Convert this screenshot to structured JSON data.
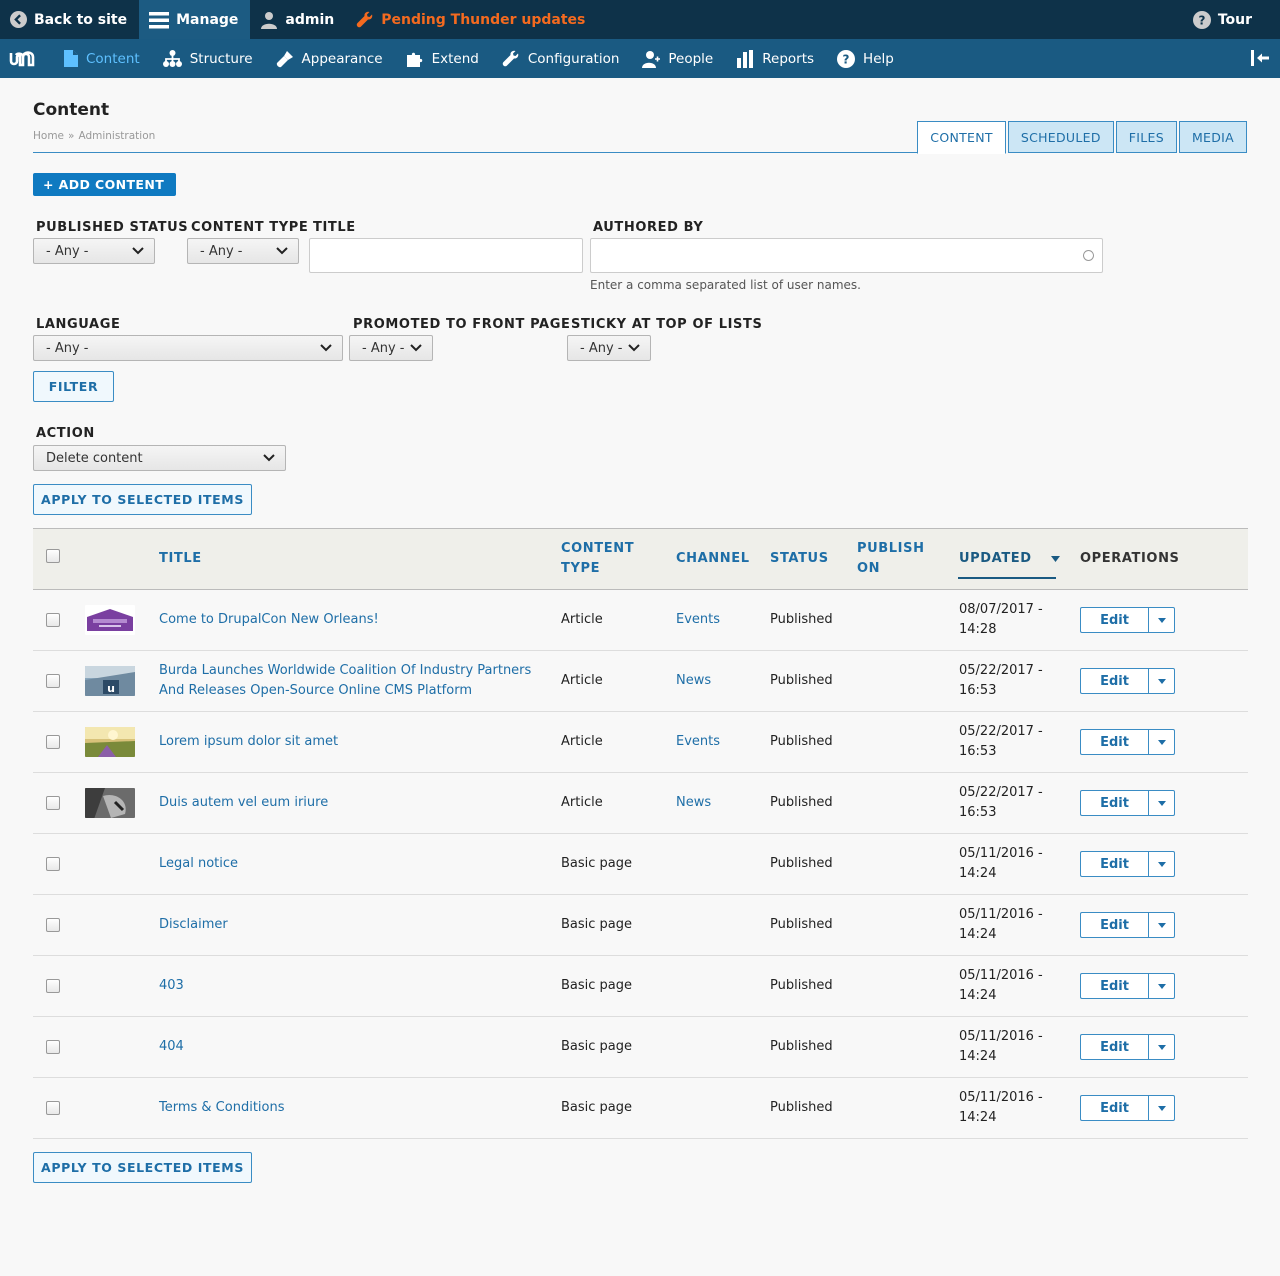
{
  "toolbar": {
    "back_label": "Back to site",
    "manage_label": "Manage",
    "user_label": "admin",
    "pending_label": "Pending Thunder updates",
    "tour_label": "Tour"
  },
  "tray": {
    "items": [
      {
        "label": "Content"
      },
      {
        "label": "Structure"
      },
      {
        "label": "Appearance"
      },
      {
        "label": "Extend"
      },
      {
        "label": "Configuration"
      },
      {
        "label": "People"
      },
      {
        "label": "Reports"
      },
      {
        "label": "Help"
      }
    ]
  },
  "page": {
    "title": "Content",
    "breadcrumb": [
      "Home",
      "Administration"
    ],
    "breadcrumb_sep": "»",
    "tabs": [
      "CONTENT",
      "SCHEDULED",
      "FILES",
      "MEDIA"
    ],
    "add_content": "+ ADD CONTENT"
  },
  "filters": {
    "published_status": {
      "label": "PUBLISHED STATUS",
      "value": "- Any -"
    },
    "content_type": {
      "label": "CONTENT TYPE",
      "value": "- Any -"
    },
    "title": {
      "label": "TITLE",
      "value": ""
    },
    "authored_by": {
      "label": "AUTHORED BY",
      "value": "",
      "description": "Enter a comma separated list of user names."
    },
    "language": {
      "label": "LANGUAGE",
      "value": "- Any -"
    },
    "promoted": {
      "label": "PROMOTED TO FRONT PAGE",
      "value": "- Any -"
    },
    "sticky": {
      "label": "STICKY AT TOP OF LISTS",
      "value": "- Any -"
    },
    "filter_button": "FILTER"
  },
  "bulk": {
    "action_label": "ACTION",
    "action_value": "Delete content",
    "apply_label": "APPLY TO SELECTED ITEMS"
  },
  "table": {
    "headers": {
      "title": "TITLE",
      "content_type_1": "CONTENT",
      "content_type_2": "TYPE",
      "channel": "CHANNEL",
      "status": "STATUS",
      "publish_on_1": "PUBLISH",
      "publish_on_2": "ON",
      "updated": "UPDATED",
      "operations": "OPERATIONS"
    },
    "edit_label": "Edit",
    "rows": [
      {
        "title_1": "Come to DrupalCon New Orleans!",
        "title_2": "",
        "type": "Article",
        "channel": "Events",
        "status": "Published",
        "date": "08/07/2017 -",
        "time": "14:28"
      },
      {
        "title_1": "Burda Launches Worldwide Coalition Of Industry Partners",
        "title_2": "And Releases Open-Source Online CMS Platform",
        "type": "Article",
        "channel": "News",
        "status": "Published",
        "date": "05/22/2017 -",
        "time": "16:53"
      },
      {
        "title_1": "Lorem ipsum dolor sit amet",
        "title_2": "",
        "type": "Article",
        "channel": "Events",
        "status": "Published",
        "date": "05/22/2017 -",
        "time": "16:53"
      },
      {
        "title_1": "Duis autem vel eum iriure",
        "title_2": "",
        "type": "Article",
        "channel": "News",
        "status": "Published",
        "date": "05/22/2017 -",
        "time": "16:53"
      },
      {
        "title_1": "Legal notice",
        "title_2": "",
        "type": "Basic page",
        "channel": "",
        "status": "Published",
        "date": "05/11/2016 -",
        "time": "14:24"
      },
      {
        "title_1": "Disclaimer",
        "title_2": "",
        "type": "Basic page",
        "channel": "",
        "status": "Published",
        "date": "05/11/2016 -",
        "time": "14:24"
      },
      {
        "title_1": "403",
        "title_2": "",
        "type": "Basic page",
        "channel": "",
        "status": "Published",
        "date": "05/11/2016 -",
        "time": "14:24"
      },
      {
        "title_1": "404",
        "title_2": "",
        "type": "Basic page",
        "channel": "",
        "status": "Published",
        "date": "05/11/2016 -",
        "time": "14:24"
      },
      {
        "title_1": "Terms & Conditions",
        "title_2": "",
        "type": "Basic page",
        "channel": "",
        "status": "Published",
        "date": "05/11/2016 -",
        "time": "14:24"
      }
    ]
  }
}
